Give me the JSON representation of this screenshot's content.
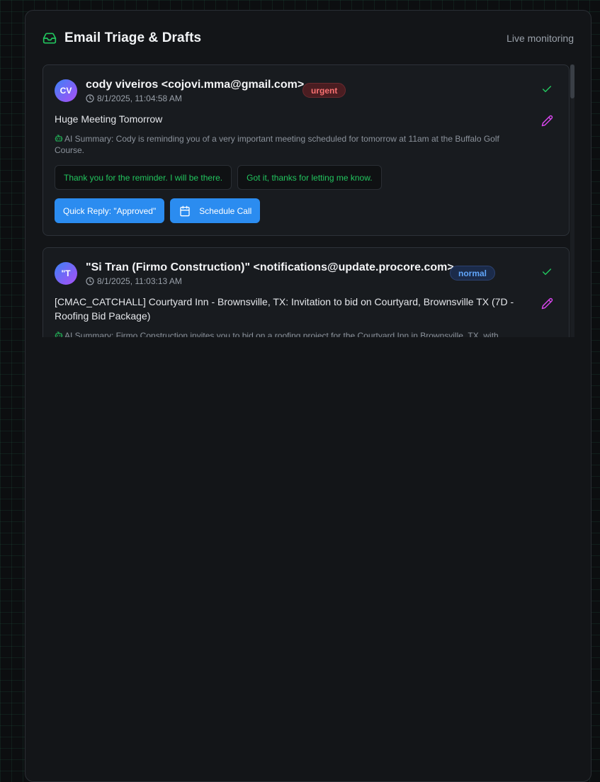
{
  "header": {
    "title": "Email Triage & Drafts",
    "status": "Live monitoring",
    "icon": "inbox-icon"
  },
  "colors": {
    "accent_green": "#22c55e",
    "primary_blue": "#2b8cf0",
    "urgent_red": "#f87171",
    "normal_blue": "#60a5fa",
    "edit_magenta": "#d946ef"
  },
  "emails": [
    {
      "avatar": "CV",
      "sender": "cody viveiros <cojovi.mma@gmail.com>",
      "priority": "urgent",
      "timestamp": "8/1/2025, 11:04:58 AM",
      "subject": "Huge Meeting Tomorrow",
      "summary": "AI Summary: Cody is reminding you of a very important meeting scheduled for tomorrow at 11am at the Buffalo Golf Course.",
      "suggested_replies": [
        "Thank you for the reminder. I will be there.",
        "Got it, thanks for letting me know."
      ],
      "actions": {
        "quick_reply": "Quick Reply: \"Approved\"",
        "schedule_call": "Schedule Call"
      }
    },
    {
      "avatar": "\"T",
      "sender": "\"Si Tran (Firmo Construction)\" <notifications@update.procore.com>",
      "priority": "normal",
      "timestamp": "8/1/2025, 11:03:13 AM",
      "subject": "[CMAC_CATCHALL] Courtyard Inn - Brownsville, TX: Invitation to bid on Courtyard, Brownsville TX (7D - Roofing Bid Package)",
      "summary": "AI Summary: Firmo Construction invites you to bid on a roofing project for the Courtyard Inn in Brownsville, TX, with"
    }
  ]
}
